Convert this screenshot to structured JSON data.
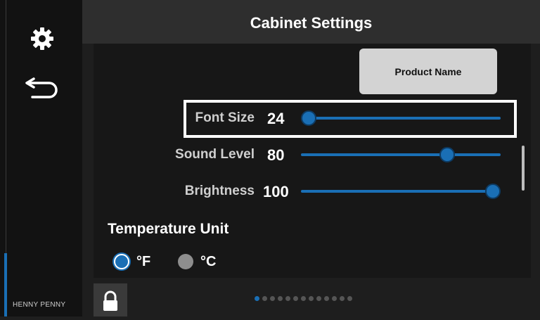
{
  "header": {
    "title": "Cabinet Settings"
  },
  "sidebar": {
    "settings_icon": "gear-icon",
    "back_icon": "back-arrow-icon",
    "brand": "HENNY PENNY"
  },
  "product_button": {
    "label": "Product Name"
  },
  "sliders": [
    {
      "label": "Font Size",
      "value": "24",
      "fraction": 0.0
    },
    {
      "label": "Sound Level",
      "value": "80",
      "fraction": 0.75
    },
    {
      "label": "Brightness",
      "value": "100",
      "fraction": 1.0
    }
  ],
  "temperature": {
    "heading": "Temperature Unit",
    "options": [
      {
        "label": "°F",
        "selected": true
      },
      {
        "label": "°C",
        "selected": false
      }
    ]
  },
  "footer": {
    "lock_icon": "lock-icon",
    "pager": {
      "total": 13,
      "active": 0
    }
  },
  "colors": {
    "accent": "#1a6fb5",
    "background": "#1e1e1e",
    "button": "#d3d3d3"
  }
}
